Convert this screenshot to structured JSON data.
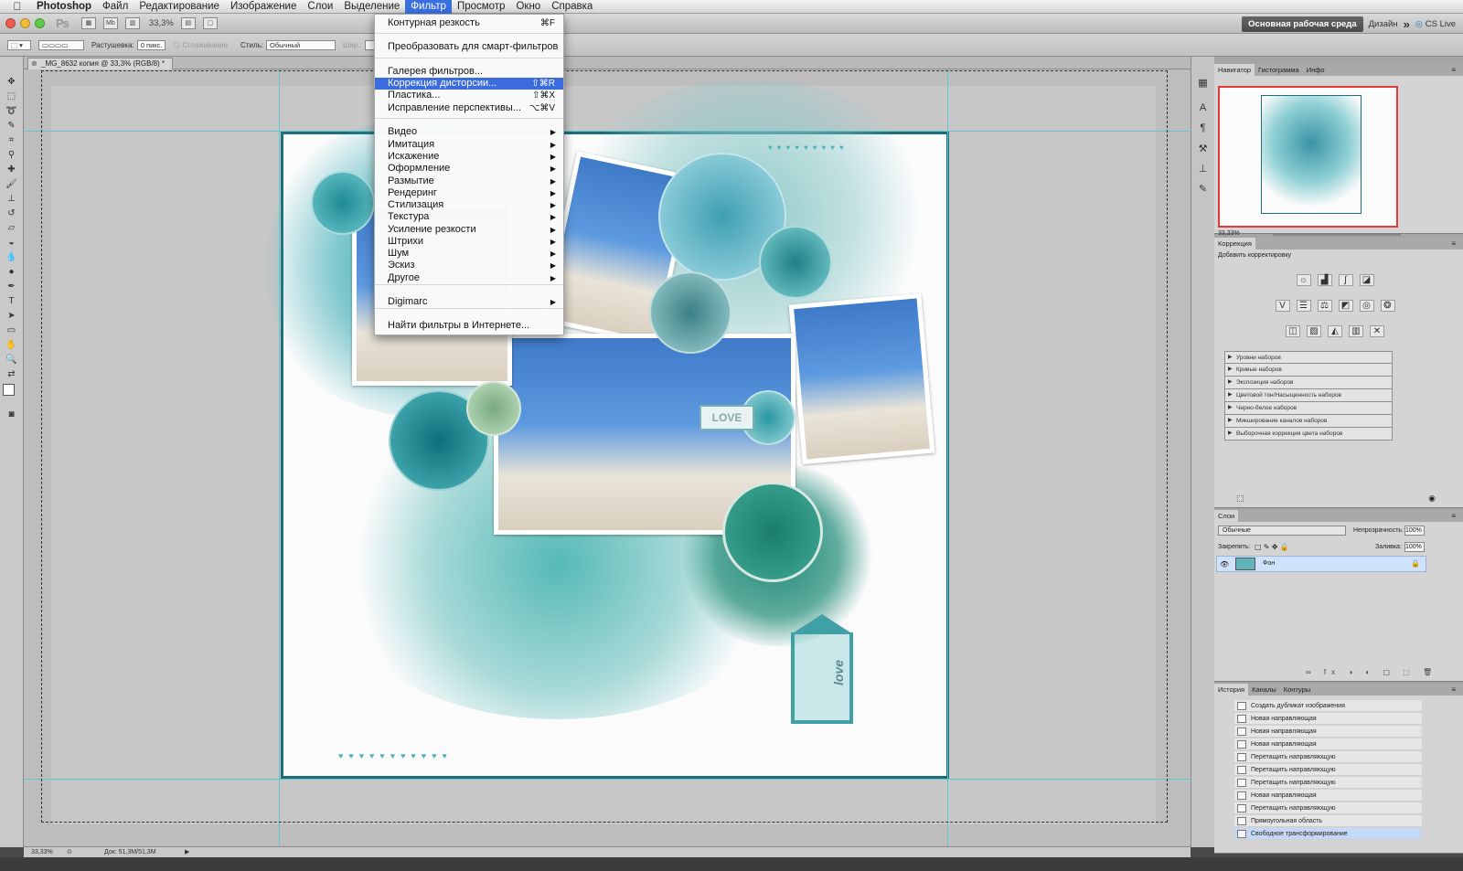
{
  "menubar": {
    "items": [
      "Photoshop",
      "Файл",
      "Редактирование",
      "Изображение",
      "Слои",
      "Выделение",
      "Фильтр",
      "Просмотр",
      "Окно",
      "Справка"
    ],
    "active": "Фильтр"
  },
  "appbar": {
    "logo": "Ps",
    "mb_label": "Mb",
    "zoom": "33,3%",
    "workspace_button": "Основная рабочая среда",
    "workspace_design": "Дизайн",
    "more": "»",
    "cs_live": "CS Live"
  },
  "options": {
    "feather_label": "Растушевка:",
    "feather_value": "0 пикс.",
    "antialias": "Сглаживание",
    "style_label": "Стиль:",
    "style_value": "Обычный",
    "width_label": "Шир.:"
  },
  "document": {
    "tab": "_MG_8632 копия @ 33,3% (RGB/8) *",
    "love_text": "LOVE",
    "love_small": "love"
  },
  "filter_menu": {
    "items": [
      {
        "label": "Контурная резкость",
        "shortcut": "⌘F"
      },
      {
        "label": "Преобразовать для смарт-фильтров"
      },
      {
        "label": "Галерея фильтров..."
      },
      {
        "label": "Коррекция дисторсии...",
        "shortcut": "⇧⌘R",
        "highlighted": true
      },
      {
        "label": "Пластика...",
        "shortcut": "⇧⌘X"
      },
      {
        "label": "Исправление перспективы...",
        "shortcut": "⌥⌘V"
      },
      {
        "label": "Видео",
        "submenu": true
      },
      {
        "label": "Имитация",
        "submenu": true
      },
      {
        "label": "Искажение",
        "submenu": true
      },
      {
        "label": "Оформление",
        "submenu": true
      },
      {
        "label": "Размытие",
        "submenu": true
      },
      {
        "label": "Рендеринг",
        "submenu": true
      },
      {
        "label": "Стилизация",
        "submenu": true
      },
      {
        "label": "Текстура",
        "submenu": true
      },
      {
        "label": "Усиление резкости",
        "submenu": true
      },
      {
        "label": "Штрихи",
        "submenu": true
      },
      {
        "label": "Шум",
        "submenu": true
      },
      {
        "label": "Эскиз",
        "submenu": true
      },
      {
        "label": "Другое",
        "submenu": true
      },
      {
        "label": "Digimarc",
        "submenu": true
      },
      {
        "label": "Найти фильтры в Интернете..."
      }
    ]
  },
  "navigator": {
    "tabs": [
      "Навигатор",
      "Гистограмма",
      "Инфо"
    ],
    "zoom": "33,33%"
  },
  "corrections": {
    "tab": "Коррекция",
    "subtitle": "Добавить корректировку",
    "presets": [
      "Уровни наборов",
      "Кривые наборов",
      "Экспозиция наборов",
      "Цветовой тон/Насыщенность наборов",
      "Черно-белое наборов",
      "Микширование каналов наборов",
      "Выборочная коррекция цвета наборов"
    ]
  },
  "layers": {
    "tab": "Слои",
    "blend_mode": "Обычные",
    "opacity_label": "Непрозрачность:",
    "opacity_value": "100%",
    "lock_label": "Закрепить:",
    "fill_label": "Заливка:",
    "fill_value": "100%",
    "layer_name": "Фон"
  },
  "history": {
    "tabs": [
      "История",
      "Каналы",
      "Контуры"
    ],
    "items": [
      "Создать дубликат изображения",
      "Новая направляющая",
      "Новая направляющая",
      "Новая направляющая",
      "Перетащить направляющую",
      "Перетащить направляющую",
      "Перетащить направляющую",
      "Новая направляющая",
      "Перетащить направляющую",
      "Прямоугольная область",
      "Свободное трансформирование"
    ]
  },
  "status": {
    "zoom": "33,33%",
    "doc": "Док: 51,3М/51,3М"
  },
  "colors": {
    "menu_highlight": "#3b6bdd",
    "guide": "#5fc6d2",
    "nav_frame": "#e23a3a"
  }
}
